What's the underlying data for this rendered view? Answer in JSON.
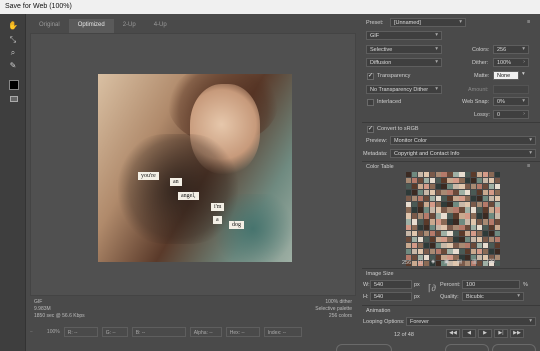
{
  "window": {
    "title": "Save for Web (100%)"
  },
  "tools": [
    "hand-icon",
    "slice-select-icon",
    "zoom-icon",
    "eyedropper-icon"
  ],
  "tabs": [
    {
      "label": "Original"
    },
    {
      "label": "Optimized"
    },
    {
      "label": "2-Up"
    },
    {
      "label": "4-Up"
    }
  ],
  "preview": {
    "words": [
      "you're",
      "an",
      "angel,",
      "i'm",
      "a",
      "dog"
    ]
  },
  "status": {
    "format": "GIF",
    "size": "9.983M",
    "time": "1850 sec @ 56.6 Kbps",
    "dither": "100% dither",
    "palette": "Selective palette",
    "colors": "256 colors"
  },
  "bottom": {
    "zoom": "100%",
    "r": "R: --",
    "g": "G: --",
    "b": "B: --",
    "alpha": "Alpha: --",
    "hex": "Hex: --",
    "index": "Index: --"
  },
  "panel": {
    "preset_label": "Preset:",
    "preset_value": "[Unnamed]",
    "format_value": "GIF",
    "reduction_value": "Selective",
    "dither_algo": "Diffusion",
    "colors_label": "Colors:",
    "colors_value": "256",
    "dither_label": "Dither:",
    "dither_value": "100%",
    "transparency_label": "Transparency",
    "matte_label": "Matte:",
    "matte_value": "None",
    "trans_dither_value": "No Transparency Dither",
    "amount_label": "Amount:",
    "interlaced_label": "Interlaced",
    "websnap_label": "Web Snap:",
    "websnap_value": "0%",
    "lossy_label": "Lossy:",
    "lossy_value": "0",
    "convert_label": "Convert to sRGB",
    "preview_label": "Preview:",
    "preview_value": "Monitor Color",
    "metadata_label": "Metadata:",
    "metadata_value": "Copyright and Contact Info",
    "color_table_label": "Color Table",
    "color_count": "256",
    "image_size_label": "Image Size",
    "w_label": "W:",
    "w_value": "540",
    "h_label": "H:",
    "h_value": "540",
    "px": "px",
    "percent_label": "Percent:",
    "percent_value": "100",
    "percent_unit": "%",
    "quality_label": "Quality:",
    "quality_value": "Bicubic",
    "animation_label": "Animation",
    "looping_label": "Looping Options:",
    "looping_value": "Forever",
    "frame_counter": "12 of 48"
  },
  "colors": {
    "palette": [
      "#3b2a22",
      "#6b4a3a",
      "#8a6a55",
      "#a88a73",
      "#c9a98f",
      "#e0c6ad",
      "#4a5a55",
      "#6f8a80",
      "#9fb0a5",
      "#2e3a38",
      "#b57a6a",
      "#d49a88",
      "#7a5a4a",
      "#5a3a2a",
      "#c8b8a8",
      "#e8ddd0"
    ]
  }
}
